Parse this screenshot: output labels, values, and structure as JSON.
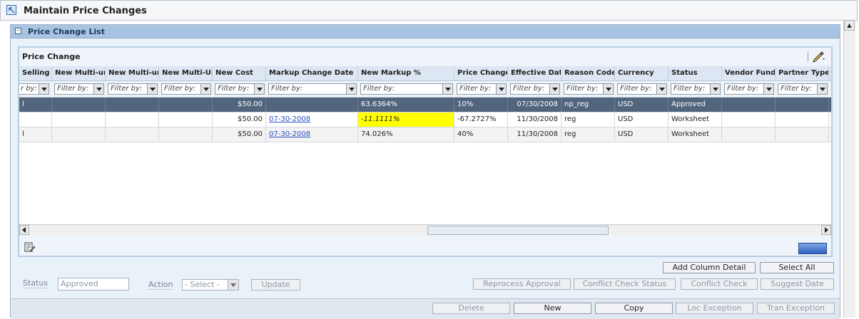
{
  "page": {
    "title": "Maintain Price Changes"
  },
  "section": {
    "title": "Price Change List"
  },
  "panel": {
    "title": "Price Change"
  },
  "columns": [
    "Selling U",
    "New Multi-unit",
    "New Multi-unit",
    "New Multi-Unit",
    "New Cost",
    "Markup Change Date",
    "New Markup %",
    "Price Change %",
    "Effective Date",
    "Reason Code",
    "Currency",
    "Status",
    "Vendor Funding",
    "Partner Type"
  ],
  "filter_placeholder": "Filter by:",
  "first_filter_text": "r by:",
  "rows": [
    {
      "c0": "l",
      "cost": "",
      "mdate": "",
      "markup": "63.6364%",
      "pct": "10%",
      "eff": "07/30/2008",
      "reason": "np_reg",
      "cur": "USD",
      "status": "Approved"
    },
    {
      "c0": "",
      "cost": "$50.00",
      "mdate": "07-30-2008",
      "markup": "-11.1111%",
      "pct": "-67.2727%",
      "eff": "11/30/2008",
      "reason": "reg",
      "cur": "USD",
      "status": "Worksheet"
    },
    {
      "c0": "l",
      "cost": "$50.00",
      "mdate": "07-30-2008",
      "markup": "74.026%",
      "pct": "40%",
      "eff": "11/30/2008",
      "reason": "reg",
      "cur": "USD",
      "status": "Worksheet"
    }
  ],
  "row0_cost": "$50.00",
  "form": {
    "status_label": "Status",
    "status_value": "Approved",
    "action_label": "Action",
    "action_value": "- Select -",
    "update": "Update"
  },
  "buttons": {
    "add_column_detail": "Add Column Detail",
    "select_all": "Select All",
    "reprocess_approval": "Reprocess Approval",
    "conflict_check_status": "Conflict Check Status",
    "conflict_check": "Conflict Check",
    "suggest_date": "Suggest Date",
    "delete": "Delete",
    "new": "New",
    "copy": "Copy",
    "loc_exception": "Loc Exception",
    "tran_exception": "Tran Exception"
  },
  "colors": {
    "header": "#a9c4e2",
    "selected_row": "#51657d",
    "warning": "#ffff00",
    "link": "#2a52be"
  }
}
